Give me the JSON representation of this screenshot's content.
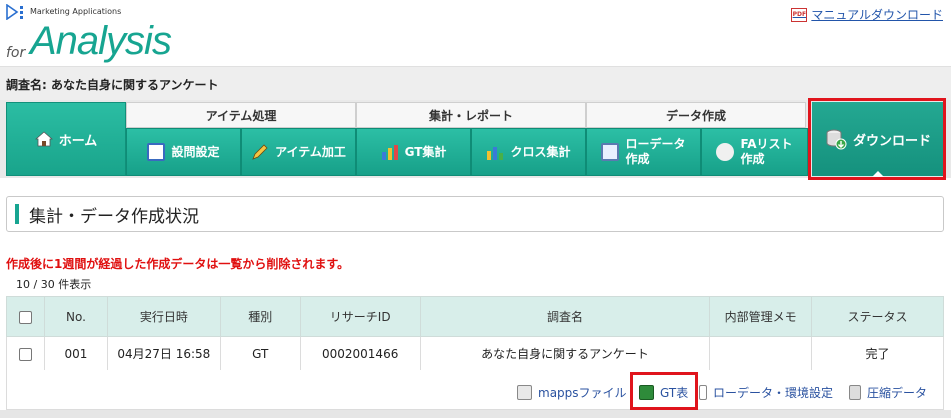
{
  "header": {
    "logo_sub": "Marketing Applications",
    "logo_for": "for",
    "logo_main": "Analysis",
    "manual_link": "マニュアルダウンロード",
    "pdf_label": "PDF"
  },
  "survey": {
    "label": "調査名: あなた自身に関するアンケート"
  },
  "nav": {
    "home": "ホーム",
    "groups": [
      "アイテム処理",
      "集計・レポート",
      "データ作成"
    ],
    "tabs": [
      {
        "label": "設問設定"
      },
      {
        "label": "アイテム加工"
      },
      {
        "label": "GT集計"
      },
      {
        "label": "クロス集計"
      },
      {
        "label1": "ローデータ",
        "label2": "作成"
      },
      {
        "label1": "FAリスト",
        "label2": "作成"
      }
    ],
    "download": "ダウンロード"
  },
  "section": {
    "title": "集計・データ作成状況"
  },
  "notice": "作成後に1週間が経過した作成データは一覧から削除されます。",
  "count": "10 / 30 件表示",
  "table": {
    "headers": [
      "No.",
      "実行日時",
      "種別",
      "リサーチID",
      "調査名",
      "内部管理メモ",
      "ステータス"
    ],
    "rows": [
      [
        "001",
        "04月27日 16:58",
        "GT",
        "0002001466",
        "あなた自身に関するアンケート",
        "",
        "完了"
      ]
    ]
  },
  "actions": {
    "mapps": "mappsファイル",
    "gt": "GT表",
    "rawdata": "ローデータ・環境設定",
    "zip": "圧縮データ"
  },
  "colors": {
    "brand": "#17a591",
    "highlight": "#e0141c",
    "link": "#2a52a0",
    "notice": "#e01010"
  }
}
